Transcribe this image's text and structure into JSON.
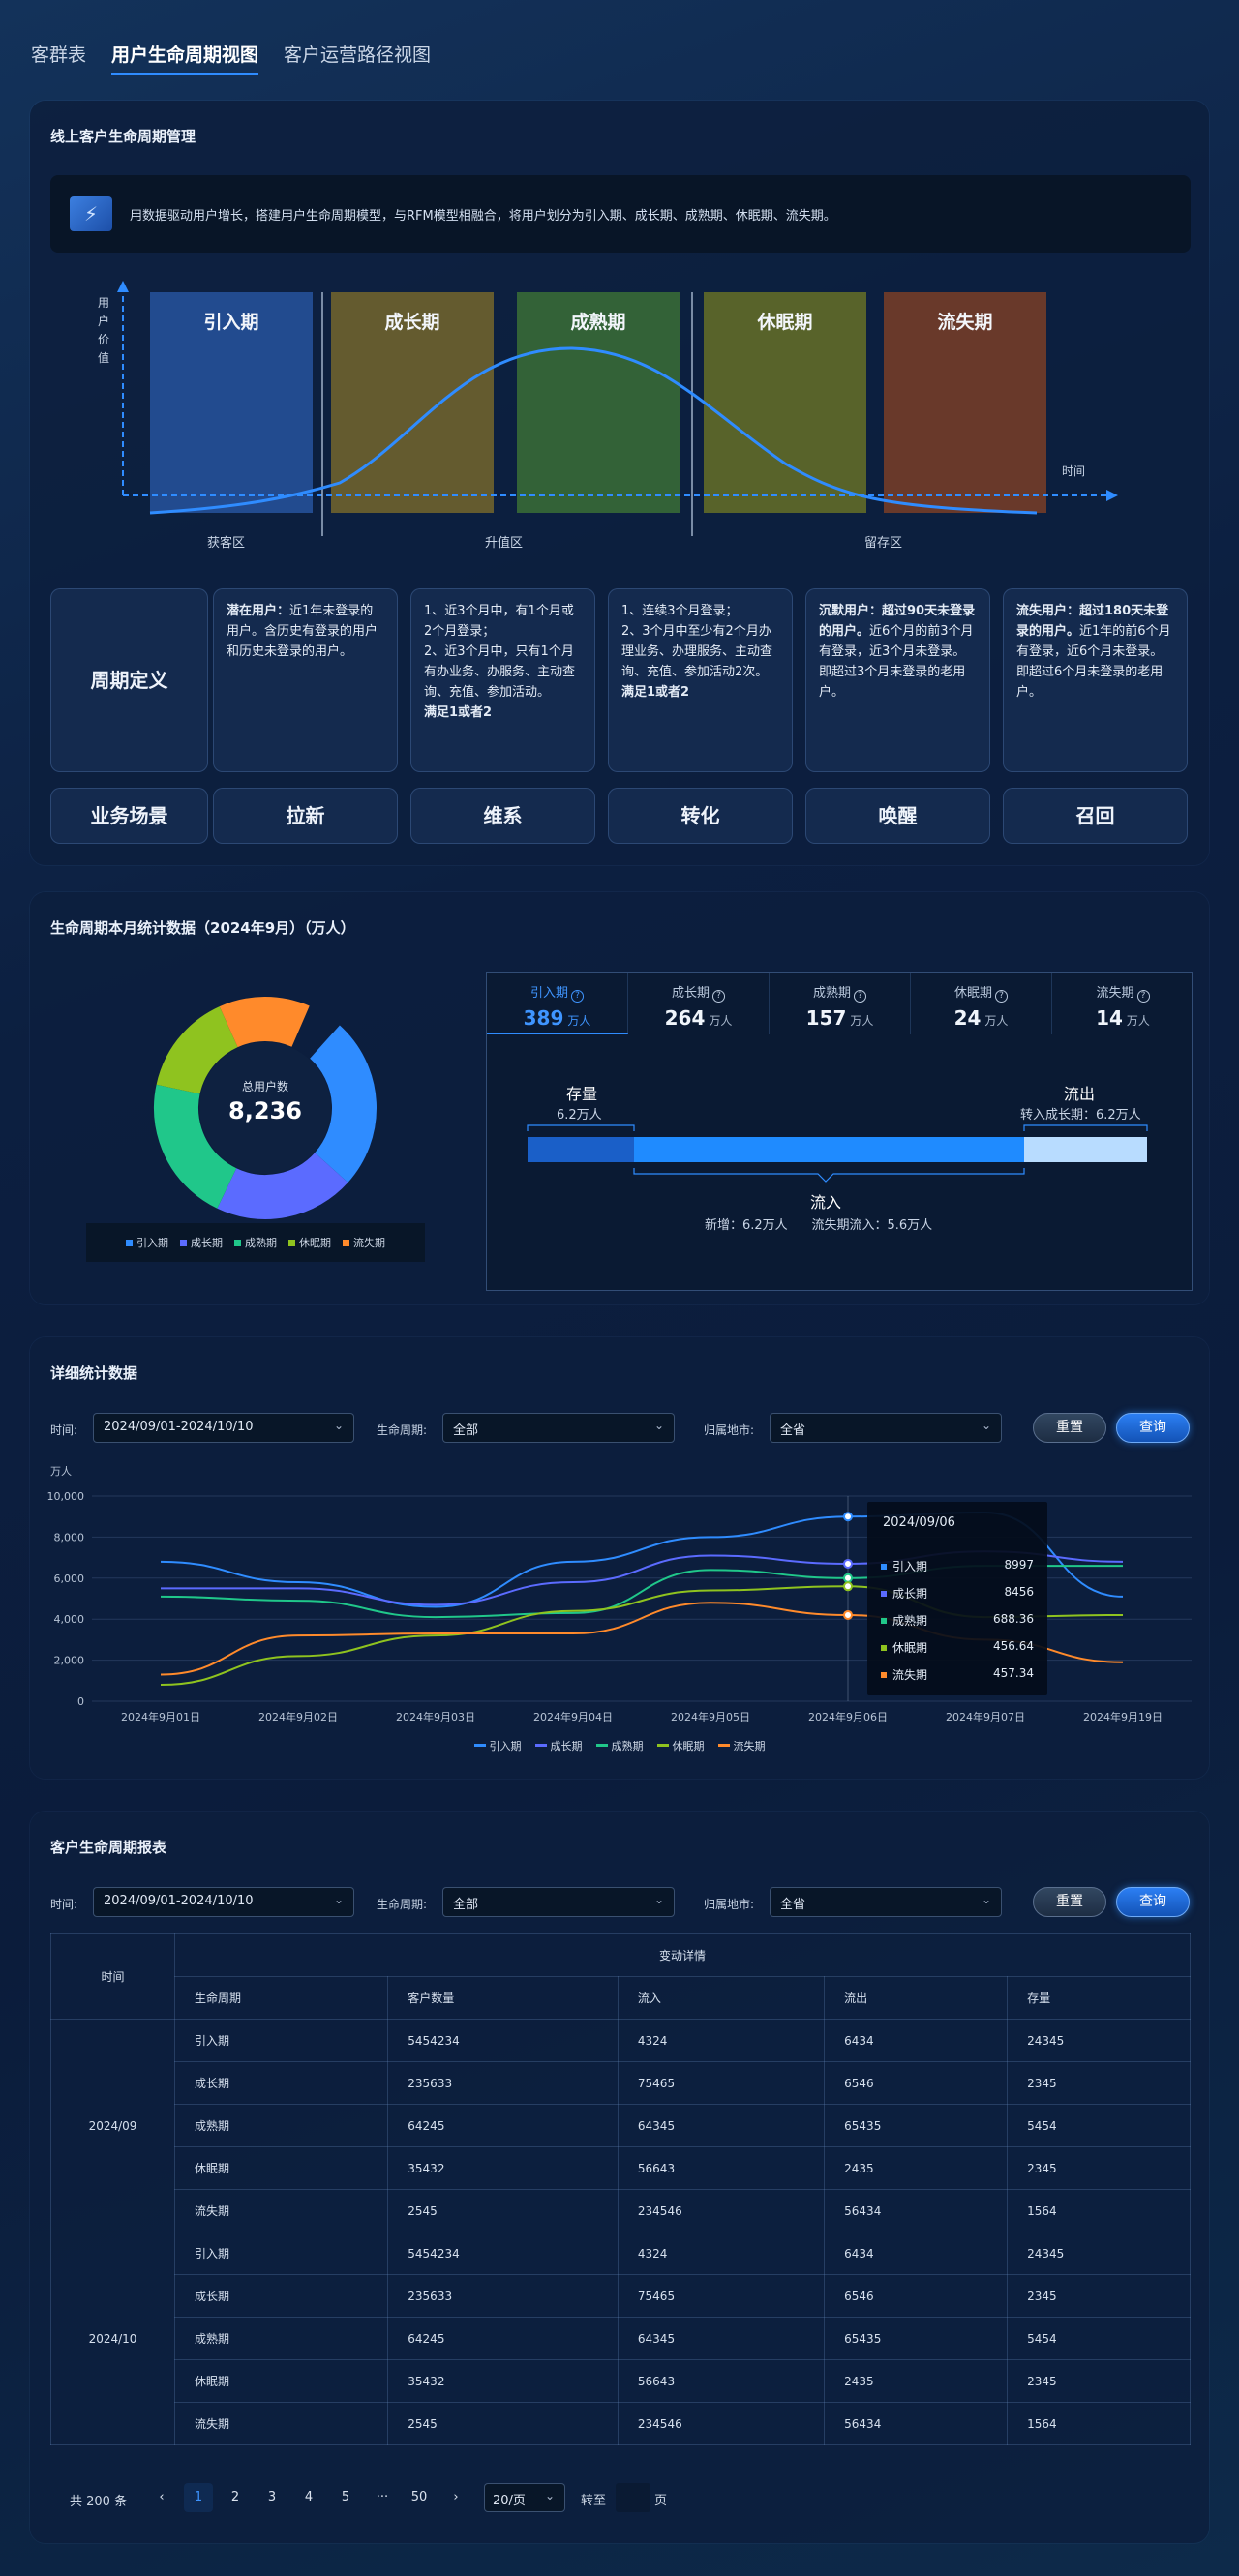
{
  "tabs": [
    "客群表",
    "用户生命周期视图",
    "客户运营路径视图"
  ],
  "section1": {
    "title": "线上客户生命周期管理",
    "banner": "用数据驱动用户增长，搭建用户生命周期模型，与RFM模型相融合，将用户划分为引入期、成长期、成熟期、休眠期、流失期。",
    "y_axis": "用户价值",
    "x_axis": "时间",
    "stages": [
      "引入期",
      "成长期",
      "成熟期",
      "休眠期",
      "流失期"
    ],
    "zones": [
      "获客区",
      "升值区",
      "留存区"
    ],
    "row_def": "周期定义",
    "row_scene": "业务场景",
    "definitions": [
      {
        "bold": "潜在用户：",
        "text": "近1年未登录的用户。含历史有登录的用户和历史未登录的用户。",
        "extra": ""
      },
      {
        "bold": "",
        "text": "1、近3个月中，有1个月或2个月登录；\n2、近3个月中，只有1个月有办业务、办服务、主动查询、充值、参加活动。",
        "extra": "满足1或者2"
      },
      {
        "bold": "",
        "text": "1、连续3个月登录；\n2、3个月中至少有2个月办理业务、办理服务、主动查询、充值、参加活动2次。",
        "extra": "满足1或者2"
      },
      {
        "bold": "沉默用户：超过90天未登录的用户。",
        "text": "近6个月的前3个月有登录，近3个月未登录。即超过3个月未登录的老用户。",
        "extra": ""
      },
      {
        "bold": "流失用户：超过180天未登录的用户。",
        "text": "近1年的前6个月有登录，近6个月未登录。即超过6个月未登录的老用户。",
        "extra": ""
      }
    ],
    "scenarios": [
      "拉新",
      "维系",
      "转化",
      "唤醒",
      "召回"
    ]
  },
  "section2": {
    "title": "生命周期本月统计数据（2024年9月）（万人）",
    "donut_label": "总用户数",
    "donut_value": "8,236",
    "legend": [
      "引入期",
      "成长期",
      "成熟期",
      "休眠期",
      "流失期"
    ],
    "tabs": [
      {
        "name": "引入期",
        "value": "389",
        "unit": "万人"
      },
      {
        "name": "成长期",
        "value": "264",
        "unit": "万人"
      },
      {
        "name": "成熟期",
        "value": "157",
        "unit": "万人"
      },
      {
        "name": "休眠期",
        "value": "24",
        "unit": "万人"
      },
      {
        "name": "流失期",
        "value": "14",
        "unit": "万人"
      }
    ],
    "stock_label": "存量",
    "stock_value": "6.2万人",
    "outflow_label": "流出",
    "outflow_value": "转入成长期：6.2万人",
    "inflow_label": "流入",
    "inflow_value": "新增：6.2万人      流失期流入：5.6万人"
  },
  "section3": {
    "title": "详细统计数据",
    "filters": {
      "time_label": "时间:",
      "time_value": "2024/09/01-2024/10/10",
      "cycle_label": "生命周期:",
      "cycle_value": "全部",
      "region_label": "归属地市:",
      "region_value": "全省"
    },
    "reset": "重置",
    "query": "查询",
    "unit": "万人",
    "tooltip": {
      "date": "2024/09/06",
      "rows": [
        {
          "name": "引入期",
          "value": "8997"
        },
        {
          "name": "成长期",
          "value": "8456"
        },
        {
          "name": "成熟期",
          "value": "688.36"
        },
        {
          "name": "休眠期",
          "value": "456.64"
        },
        {
          "name": "流失期",
          "value": "457.34"
        }
      ]
    }
  },
  "chart_data": {
    "type": "line",
    "x": [
      "2024年9月01日",
      "2024年9月02日",
      "2024年9月03日",
      "2024年9月04日",
      "2024年9月05日",
      "2024年9月06日",
      "2024年9月07日",
      "2024年9月19日"
    ],
    "ylim": [
      0,
      10000
    ],
    "yticks": [
      "0",
      "2,000",
      "4,000",
      "6,000",
      "8,000",
      "10,000"
    ],
    "series": [
      {
        "name": "引入期",
        "color": "#2f8cff",
        "values": [
          6800,
          5800,
          4600,
          6800,
          8000,
          8997,
          9200,
          5100
        ]
      },
      {
        "name": "成长期",
        "color": "#5b6bff",
        "values": [
          5500,
          5500,
          4700,
          5800,
          7100,
          6700,
          7300,
          6800
        ]
      },
      {
        "name": "成熟期",
        "color": "#20c78a",
        "values": [
          5100,
          4900,
          4100,
          4300,
          6400,
          6000,
          6600,
          6600
        ]
      },
      {
        "name": "休眠期",
        "color": "#8fc31f",
        "values": [
          800,
          2200,
          3200,
          4400,
          5400,
          5600,
          4100,
          4200
        ]
      },
      {
        "name": "流失期",
        "color": "#ff8a2b",
        "values": [
          1300,
          3200,
          3300,
          3300,
          4800,
          4200,
          3000,
          1900
        ]
      }
    ]
  },
  "section4": {
    "title": "客户生命周期报表",
    "header_time": "时间",
    "header_group": "变动详情",
    "columns": [
      "生命周期",
      "客户数量",
      "流入",
      "流出",
      "存量"
    ],
    "groups": [
      {
        "period": "2024/09",
        "rows": [
          [
            "引入期",
            "5454234",
            "4324",
            "6434",
            "24345"
          ],
          [
            "成长期",
            "235633",
            "75465",
            "6546",
            "2345"
          ],
          [
            "成熟期",
            "64245",
            "64345",
            "65435",
            "5454"
          ],
          [
            "休眠期",
            "35432",
            "56643",
            "2435",
            "2345"
          ],
          [
            "流失期",
            "2545",
            "234546",
            "56434",
            "1564"
          ]
        ]
      },
      {
        "period": "2024/10",
        "rows": [
          [
            "引入期",
            "5454234",
            "4324",
            "6434",
            "24345"
          ],
          [
            "成长期",
            "235633",
            "75465",
            "6546",
            "2345"
          ],
          [
            "成熟期",
            "64245",
            "64345",
            "65435",
            "5454"
          ],
          [
            "休眠期",
            "35432",
            "56643",
            "2435",
            "2345"
          ],
          [
            "流失期",
            "2545",
            "234546",
            "56434",
            "1564"
          ]
        ]
      }
    ],
    "pagination": {
      "total": "共 200 条",
      "pages": [
        "1",
        "2",
        "3",
        "4",
        "5",
        "···",
        "50"
      ],
      "page_size": "20/页",
      "goto": "转至",
      "page_unit": "页"
    }
  },
  "colors": {
    "intro": "#2f8cff",
    "growth": "#5b6bff",
    "mature": "#20c78a",
    "dormant": "#8fc31f",
    "lost": "#ff8a2b"
  }
}
